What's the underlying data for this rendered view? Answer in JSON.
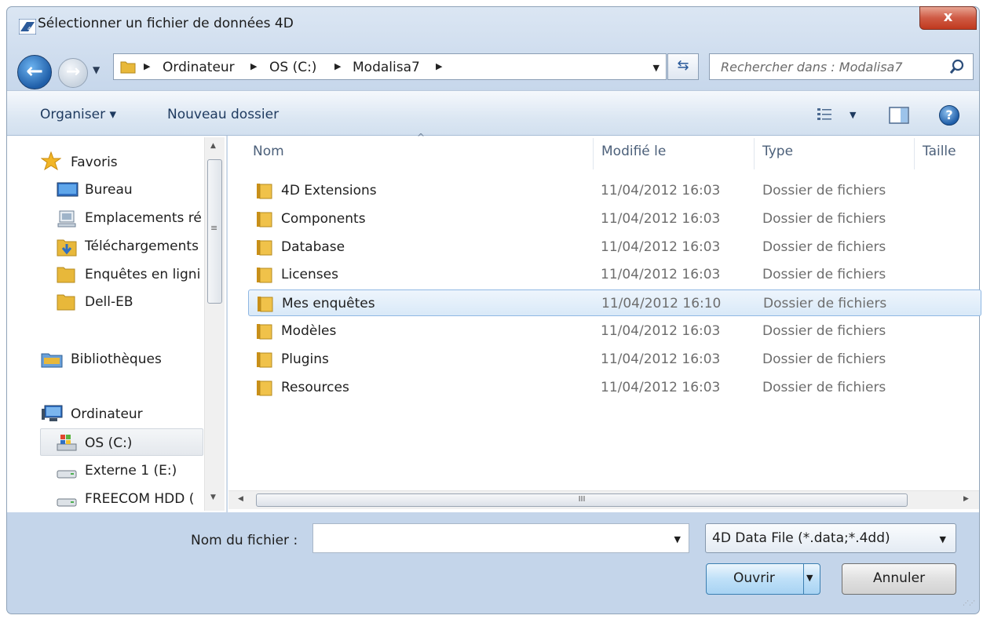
{
  "window": {
    "title": "Sélectionner un fichier de données 4D",
    "close_label": "x"
  },
  "nav": {
    "history_arrow": "▼"
  },
  "address": {
    "crumbs": [
      "Ordinateur",
      "OS (C:)",
      "Modalisa7"
    ],
    "separator": "▶",
    "dropdown": "▼"
  },
  "search": {
    "placeholder": "Rechercher dans : Modalisa7"
  },
  "toolbar": {
    "organise": "Organiser ▾",
    "new_folder": "Nouveau dossier",
    "view_dropdown": "▼",
    "help": "?"
  },
  "sidebar": {
    "favorites_label": "Favoris",
    "favorites": [
      {
        "label": "Bureau",
        "icon": "desktop-icon"
      },
      {
        "label": "Emplacements ré",
        "icon": "network-places-icon"
      },
      {
        "label": "Téléchargements",
        "icon": "downloads-icon"
      },
      {
        "label": "Enquêtes en ligni",
        "icon": "folder-icon"
      },
      {
        "label": "Dell-EB",
        "icon": "folder-icon"
      }
    ],
    "libraries_label": "Bibliothèques",
    "computer_label": "Ordinateur",
    "drives": [
      {
        "label": "OS (C:)",
        "icon": "system-drive-icon",
        "selected": true
      },
      {
        "label": "Externe 1 (E:)",
        "icon": "drive-icon"
      },
      {
        "label": "FREECOM HDD (",
        "icon": "drive-icon"
      }
    ],
    "scroll_up": "▲",
    "scroll_down": "▼",
    "scroll_grip": "≡"
  },
  "columns": {
    "name": "Nom",
    "modified": "Modifié le",
    "type": "Type",
    "size": "Taille",
    "sort_arrow": "^"
  },
  "files": [
    {
      "name": "4D Extensions",
      "modified": "11/04/2012 16:03",
      "type": "Dossier de fichiers"
    },
    {
      "name": "Components",
      "modified": "11/04/2012 16:03",
      "type": "Dossier de fichiers"
    },
    {
      "name": "Database",
      "modified": "11/04/2012 16:03",
      "type": "Dossier de fichiers"
    },
    {
      "name": "Licenses",
      "modified": "11/04/2012 16:03",
      "type": "Dossier de fichiers"
    },
    {
      "name": "Mes enquêtes",
      "modified": "11/04/2012 16:10",
      "type": "Dossier de fichiers",
      "selected": true
    },
    {
      "name": "Modèles",
      "modified": "11/04/2012 16:03",
      "type": "Dossier de fichiers"
    },
    {
      "name": "Plugins",
      "modified": "11/04/2012 16:03",
      "type": "Dossier de fichiers"
    },
    {
      "name": "Resources",
      "modified": "11/04/2012 16:03",
      "type": "Dossier de fichiers"
    }
  ],
  "hscroll": {
    "left": "◀",
    "right": "▶",
    "grip": "III"
  },
  "bottom": {
    "filename_label": "Nom du fichier :",
    "filename_value": "",
    "filename_dropdown": "▼",
    "filetype": "4D Data File (*.data;*.4dd)",
    "filetype_dropdown": "▼",
    "open": "Ouvrir",
    "open_arrow": "▼",
    "cancel": "Annuler"
  },
  "colors": {
    "accent": "#1f5ea8",
    "selection": "#d9e9f8",
    "folder": "#e8b83a"
  }
}
